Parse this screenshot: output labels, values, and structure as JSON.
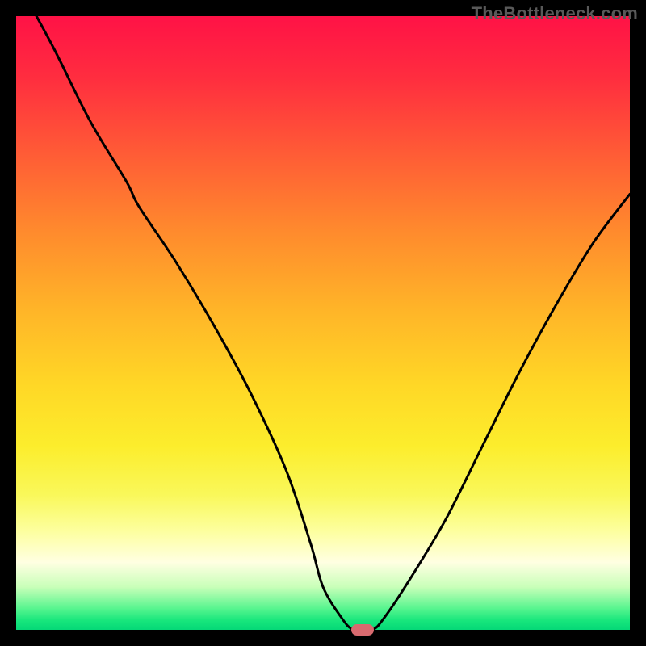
{
  "watermark": "TheBottleneck.com",
  "colors": {
    "black": "#000000",
    "curve": "#000000",
    "marker": "#d86a6f",
    "watermark": "#595959"
  },
  "chart_data": {
    "type": "line",
    "title": "",
    "xlabel": "",
    "ylabel": "",
    "xlim": [
      0,
      100
    ],
    "ylim": [
      0,
      100
    ],
    "grid": false,
    "legend": false,
    "series": [
      {
        "name": "bottleneck-curve",
        "x": [
          0,
          6,
          12,
          18,
          20,
          26,
          32,
          38,
          44,
          48,
          50,
          53,
          55,
          58,
          60,
          64,
          70,
          76,
          82,
          88,
          94,
          100
        ],
        "values": [
          106,
          95,
          83,
          73,
          69,
          60,
          50,
          39,
          26,
          14,
          7,
          2,
          0,
          0,
          2,
          8,
          18,
          30,
          42,
          53,
          63,
          71
        ]
      }
    ],
    "marker": {
      "x": 56.5,
      "y": 0
    },
    "gradient_stops": [
      {
        "pos": 0.0,
        "color": "#ff1246"
      },
      {
        "pos": 0.1,
        "color": "#ff2d3f"
      },
      {
        "pos": 0.22,
        "color": "#ff5a36"
      },
      {
        "pos": 0.35,
        "color": "#ff8a2d"
      },
      {
        "pos": 0.48,
        "color": "#ffb528"
      },
      {
        "pos": 0.6,
        "color": "#ffd726"
      },
      {
        "pos": 0.7,
        "color": "#fced2c"
      },
      {
        "pos": 0.78,
        "color": "#f9f85a"
      },
      {
        "pos": 0.84,
        "color": "#fdffa0"
      },
      {
        "pos": 0.89,
        "color": "#ffffe2"
      },
      {
        "pos": 0.93,
        "color": "#c9ffb9"
      },
      {
        "pos": 0.965,
        "color": "#58f58f"
      },
      {
        "pos": 0.985,
        "color": "#17e67c"
      },
      {
        "pos": 1.0,
        "color": "#05d877"
      }
    ]
  }
}
